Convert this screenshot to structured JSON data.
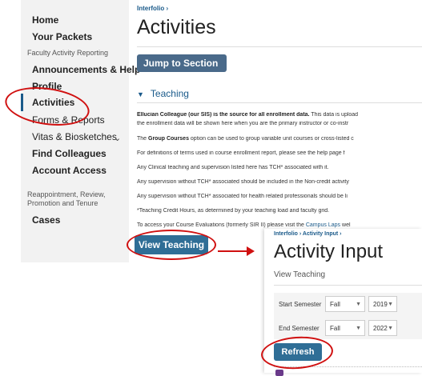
{
  "sidebar": {
    "items": [
      {
        "label": "Home"
      },
      {
        "label": "Your Packets"
      },
      {
        "label": "Faculty Activity Reporting"
      },
      {
        "label": "Announcements & Help"
      },
      {
        "label": "Profile"
      },
      {
        "label": "Activities"
      },
      {
        "label": "Forms & Reports"
      },
      {
        "label": "Vitas & Biosketches"
      },
      {
        "label": "Find Colleagues"
      },
      {
        "label": "Account Access"
      },
      {
        "label": "Reappointment, Review, Promotion and Tenure"
      },
      {
        "label": "Cases"
      }
    ],
    "active": "Activities"
  },
  "main": {
    "breadcrumb": "Interfolio ›",
    "title": "Activities",
    "jump_label": "Jump to Section",
    "section_title": "Teaching",
    "paragraphs": {
      "p1_bold": "Ellucian Colleague (our SIS) is the source for all enrollment data.",
      "p1_rest": " This data is upload",
      "p1_line2": "the enrollment data will be shown here when you are the primary instructor or co-instr",
      "p2_pre": "The ",
      "p2_bold": "Group Courses",
      "p2_rest": " option can be used to group variable unit courses or cross-listed c",
      "p3": "For definitions of terms used in course enrollment report, please see the help page f",
      "p4": "Any Clinical teaching and supervision listed here has TCH* associated with it.",
      "p5": "Any supervision without TCH* associated should be included in the Non-credit activity",
      "p6": "Any supervision without TCH* associated for health related professionals should be li",
      "p7": "*Teaching Credit Hours, as determined by your teaching load and faculty grid.",
      "p8_pre": "To access your Course Evaluations (formerly SIR II) please visit the ",
      "p8_link": "Campus Laps",
      "p8_rest": " wel"
    },
    "view_teaching_label": "View Teaching"
  },
  "panel": {
    "breadcrumb": "Interfolio › Activity Input ›",
    "title": "Activity Input",
    "subtitle": "View Teaching",
    "start_label": "Start Semester",
    "end_label": "End Semester",
    "start_term": "Fall",
    "start_year": "2019",
    "end_term": "Fall",
    "end_year": "2022",
    "refresh_label": "Refresh"
  },
  "colors": {
    "annotation": "#d01010",
    "primary_button": "#2f6e96",
    "link": "#1a5a8a"
  }
}
